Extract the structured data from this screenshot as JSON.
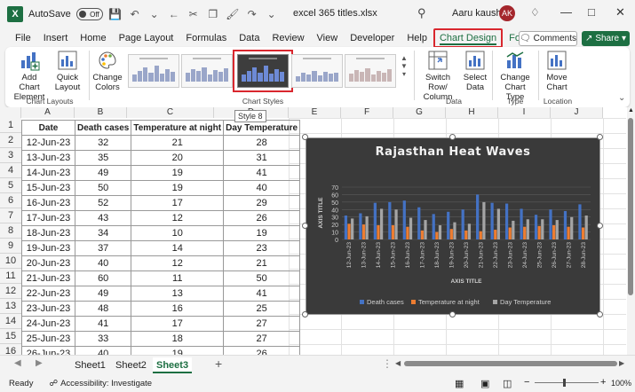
{
  "titlebar": {
    "autosave_label": "AutoSave",
    "autosave_state": "Off",
    "doc_title": "excel 365 titles.xlsx",
    "user_name": "Aaru kaushik",
    "avatar_initials": "AK"
  },
  "tabs": [
    "File",
    "Insert",
    "Home",
    "Page Layout",
    "Formulas",
    "Data",
    "Review",
    "View",
    "Developer",
    "Help",
    "Chart Design",
    "Format"
  ],
  "active_tab": "Chart Design",
  "buttons": {
    "comments": "Comments",
    "share": "Share"
  },
  "ribbon": {
    "add_chart_element": [
      "Add Chart",
      "Element"
    ],
    "quick_layout": [
      "Quick",
      "Layout"
    ],
    "change_colors": [
      "Change",
      "Colors"
    ],
    "switch_row_col": [
      "Switch Row/",
      "Column"
    ],
    "select_data": [
      "Select",
      "Data"
    ],
    "change_chart_type": [
      "Change",
      "Chart Type"
    ],
    "move_chart": [
      "Move",
      "Chart"
    ],
    "groups": {
      "chart_layouts": "Chart Layouts",
      "chart_styles": "Chart Styles",
      "data": "Data",
      "type": "Type",
      "location": "Location"
    },
    "tooltip": "Style 8"
  },
  "columns": [
    "A",
    "B",
    "C",
    "D",
    "E",
    "F",
    "G",
    "H",
    "I",
    "J"
  ],
  "table": {
    "headers": [
      "Date",
      "Death cases",
      "Temperature at night",
      "Day Temperature"
    ],
    "rows": [
      [
        "12-Jun-23",
        "32",
        "21",
        "28"
      ],
      [
        "13-Jun-23",
        "35",
        "20",
        "31"
      ],
      [
        "14-Jun-23",
        "49",
        "19",
        "41"
      ],
      [
        "15-Jun-23",
        "50",
        "19",
        "40"
      ],
      [
        "16-Jun-23",
        "52",
        "17",
        "29"
      ],
      [
        "17-Jun-23",
        "43",
        "12",
        "26"
      ],
      [
        "18-Jun-23",
        "34",
        "10",
        "19"
      ],
      [
        "19-Jun-23",
        "37",
        "14",
        "23"
      ],
      [
        "20-Jun-23",
        "40",
        "12",
        "21"
      ],
      [
        "21-Jun-23",
        "60",
        "11",
        "50"
      ],
      [
        "22-Jun-23",
        "49",
        "13",
        "41"
      ],
      [
        "23-Jun-23",
        "48",
        "16",
        "25"
      ],
      [
        "24-Jun-23",
        "41",
        "17",
        "27"
      ],
      [
        "25-Jun-23",
        "33",
        "18",
        "27"
      ],
      [
        "26-Jun-23",
        "40",
        "19",
        "26"
      ]
    ]
  },
  "chart_data": {
    "type": "bar",
    "title": "Rajasthan Heat Waves",
    "xlabel": "AXIS TITLE",
    "ylabel": "AXIS TITLE",
    "ylim": [
      0,
      70
    ],
    "yticks": [
      0,
      10,
      20,
      30,
      40,
      50,
      60,
      70
    ],
    "grid": true,
    "legend": "bottom",
    "categories": [
      "12-Jun-23",
      "13-Jun-23",
      "14-Jun-23",
      "15-Jun-23",
      "16-Jun-23",
      "17-Jun-23",
      "18-Jun-23",
      "19-Jun-23",
      "20-Jun-23",
      "21-Jun-23",
      "22-Jun-23",
      "23-Jun-23",
      "24-Jun-23",
      "25-Jun-23",
      "26-Jun-23",
      "27-Jun-23",
      "28-Jun-23"
    ],
    "series": [
      {
        "name": "Death cases",
        "color": "#4472c4",
        "values": [
          32,
          35,
          49,
          50,
          52,
          43,
          34,
          37,
          40,
          60,
          49,
          48,
          41,
          33,
          40,
          38,
          47
        ]
      },
      {
        "name": "Temperature at night",
        "color": "#ed7d31",
        "values": [
          21,
          20,
          19,
          19,
          17,
          12,
          10,
          14,
          12,
          11,
          13,
          16,
          17,
          18,
          19,
          17,
          16
        ]
      },
      {
        "name": "Day Temperature",
        "color": "#a5a5a5",
        "values": [
          28,
          31,
          41,
          40,
          29,
          26,
          19,
          23,
          21,
          50,
          41,
          25,
          27,
          27,
          26,
          30,
          32
        ]
      }
    ]
  },
  "sheets": [
    "Sheet1",
    "Sheet2",
    "Sheet3"
  ],
  "active_sheet": "Sheet3",
  "status": {
    "ready": "Ready",
    "accessibility": "Accessibility: Investigate",
    "zoom": "100%"
  }
}
